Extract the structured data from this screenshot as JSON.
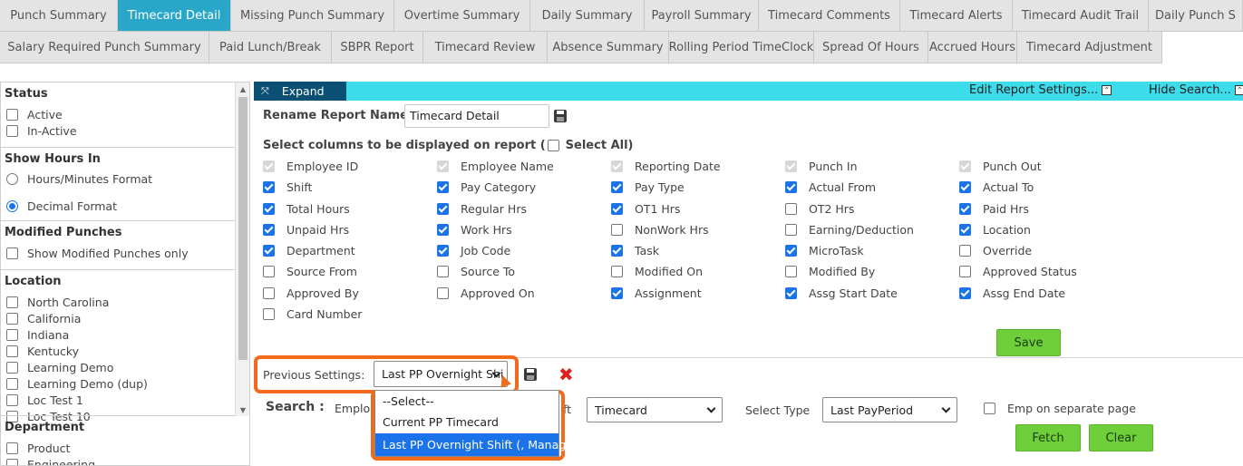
{
  "tabs_row1": [
    {
      "label": "Punch Summary",
      "active": false
    },
    {
      "label": "Timecard Detail",
      "active": true
    },
    {
      "label": "Missing Punch Summary",
      "active": false
    },
    {
      "label": "Overtime Summary",
      "active": false
    },
    {
      "label": "Daily Summary",
      "active": false
    },
    {
      "label": "Payroll Summary",
      "active": false
    },
    {
      "label": "Timecard Comments",
      "active": false
    },
    {
      "label": "Timecard Alerts",
      "active": false
    },
    {
      "label": "Timecard Audit Trail",
      "active": false
    },
    {
      "label": "Daily Punch S",
      "active": false
    }
  ],
  "tabs_row2": [
    {
      "label": "Salary Required Punch Summary"
    },
    {
      "label": "Paid Lunch/Break"
    },
    {
      "label": "SBPR Report"
    },
    {
      "label": "Timecard Review"
    },
    {
      "label": "Absence Summary"
    },
    {
      "label": "Rolling Period TimeClock"
    },
    {
      "label": "Spread Of Hours"
    },
    {
      "label": "Accrued Hours"
    },
    {
      "label": "Timecard Adjustment"
    }
  ],
  "sidebar": {
    "status_title": "Status",
    "status_options": [
      "Active",
      "In-Active"
    ],
    "hours_title": "Show Hours In",
    "hours_options": [
      "Hours/Minutes Format",
      "Decimal Format"
    ],
    "hours_selected": "Decimal Format",
    "modified_title": "Modified Punches",
    "modified_option": "Show Modified Punches only",
    "location_title": "Location",
    "locations": [
      "North Carolina",
      "California",
      "Indiana",
      "Kentucky",
      "Learning Demo",
      "Learning Demo (dup)",
      "Loc Test 1",
      "Loc Test 10"
    ],
    "department_title": "Department",
    "departments": [
      "Product",
      "Engineering"
    ]
  },
  "toolbar": {
    "expand_label": "Expand",
    "edit_settings_label": "Edit Report Settings...",
    "hide_search_label": "Hide Search..."
  },
  "report": {
    "rename_label": "Rename Report Name:",
    "report_name": "Timecard Detail",
    "select_columns_label": "Select columns to be displayed on report (",
    "select_all_label": "Select All)",
    "save_label": "Save"
  },
  "columns": [
    [
      {
        "label": "Employee ID",
        "state": "disabled"
      },
      {
        "label": "Shift",
        "state": "checked"
      },
      {
        "label": "Total Hours",
        "state": "checked"
      },
      {
        "label": "Unpaid Hrs",
        "state": "checked"
      },
      {
        "label": "Department",
        "state": "checked"
      },
      {
        "label": "Source From",
        "state": "unchecked"
      },
      {
        "label": "Approved By",
        "state": "unchecked"
      },
      {
        "label": "Card Number",
        "state": "unchecked"
      }
    ],
    [
      {
        "label": "Employee Name",
        "state": "disabled"
      },
      {
        "label": "Pay Category",
        "state": "checked"
      },
      {
        "label": "Regular Hrs",
        "state": "checked"
      },
      {
        "label": "Work Hrs",
        "state": "checked"
      },
      {
        "label": "Job Code",
        "state": "checked"
      },
      {
        "label": "Source To",
        "state": "unchecked"
      },
      {
        "label": "Approved On",
        "state": "unchecked"
      }
    ],
    [
      {
        "label": "Reporting Date",
        "state": "disabled"
      },
      {
        "label": "Pay Type",
        "state": "checked"
      },
      {
        "label": "OT1 Hrs",
        "state": "checked"
      },
      {
        "label": "NonWork Hrs",
        "state": "unchecked"
      },
      {
        "label": "Task",
        "state": "checked"
      },
      {
        "label": "Modified On",
        "state": "unchecked"
      },
      {
        "label": "Assignment",
        "state": "checked"
      }
    ],
    [
      {
        "label": "Punch In",
        "state": "disabled"
      },
      {
        "label": "Actual From",
        "state": "checked"
      },
      {
        "label": "OT2 Hrs",
        "state": "unchecked"
      },
      {
        "label": "Earning/Deduction",
        "state": "unchecked"
      },
      {
        "label": "MicroTask",
        "state": "checked"
      },
      {
        "label": "Modified By",
        "state": "unchecked"
      },
      {
        "label": "Assg Start Date",
        "state": "checked"
      }
    ],
    [
      {
        "label": "Punch Out",
        "state": "disabled"
      },
      {
        "label": "Actual To",
        "state": "checked"
      },
      {
        "label": "Paid Hrs",
        "state": "checked"
      },
      {
        "label": "Location",
        "state": "checked"
      },
      {
        "label": "Override",
        "state": "unchecked"
      },
      {
        "label": "Approved Status",
        "state": "unchecked"
      },
      {
        "label": "Assg End Date",
        "state": "checked"
      }
    ]
  ],
  "previous_settings": {
    "label": "Previous Settings:",
    "selected": "Last PP Overnight Shi",
    "options": [
      "--Select--",
      "Current PP Timecard",
      "Last PP Overnight Shift (, Manager)"
    ],
    "highlighted": "Last PP Overnight Shift (, Manager)"
  },
  "search": {
    "label": "Search :",
    "employee_label_partial": "Emplo",
    "shift_label_partial": "ft",
    "report_type_value": "Timecard",
    "select_type_label": "Select Type",
    "select_type_value": "Last PayPeriod",
    "emp_separate_label": "Emp on separate page",
    "fetch_label": "Fetch",
    "clear_label": "Clear"
  },
  "colors": {
    "accent_tab": "#2aa6c9",
    "toolbar_bar": "#3ddcea",
    "expand_bg": "#0b4f73",
    "green_button": "#6fcf3a",
    "highlight_orange": "#f26a1b",
    "checkbox_blue": "#1a73e8"
  }
}
